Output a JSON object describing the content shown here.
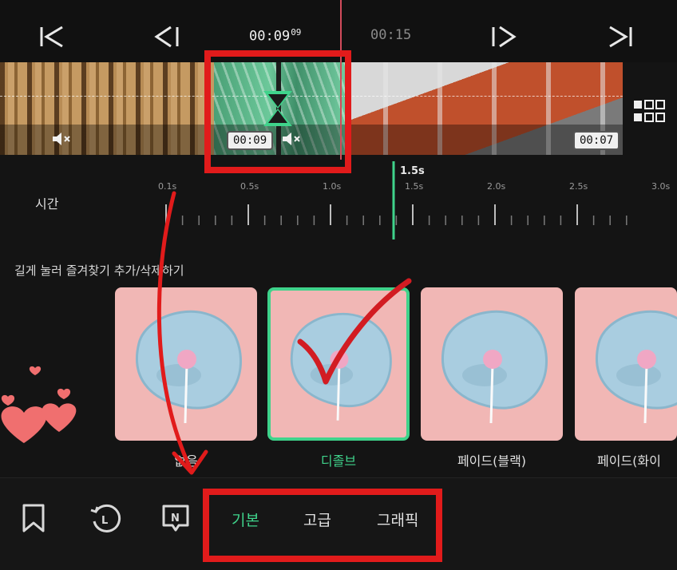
{
  "transport": {
    "current_time": "00:09",
    "current_frames": "09",
    "next_time": "00:15",
    "buttons": [
      "skip-to-start",
      "previous-frame",
      "next-frame",
      "skip-to-end"
    ]
  },
  "timeline": {
    "clips": [
      {
        "name": "wood-clip",
        "muted": true
      },
      {
        "name": "green-clip",
        "duration_badge": "00:09",
        "muted": true
      },
      {
        "name": "boat-clip",
        "duration_badge": "00:07"
      }
    ]
  },
  "ruler": {
    "label": "시간",
    "ticks": [
      "0.1s",
      "0.5s",
      "1.0s",
      "1.5s",
      "2.0s",
      "2.5s",
      "3.0s"
    ],
    "selected_value": "1.5s"
  },
  "hint": "길게 눌러 즐겨찾기 추가/삭제하기",
  "transitions": {
    "items": [
      {
        "label": "없음"
      },
      {
        "label": "디졸브"
      },
      {
        "label": "페이드(블랙)"
      },
      {
        "label": "페이드(화이"
      }
    ],
    "selected_index": 1
  },
  "bottom_bar": {
    "icons": [
      "bookmark-icon",
      "history-icon",
      "new-badge-icon"
    ],
    "tabs": [
      {
        "label": "기본",
        "active": true
      },
      {
        "label": "고급",
        "active": false
      },
      {
        "label": "그래픽",
        "active": false
      }
    ]
  },
  "colors": {
    "accent": "#3fd38b",
    "annotation_red": "#e11b1b",
    "playhead": "#d24b5b",
    "background": "#141414"
  }
}
